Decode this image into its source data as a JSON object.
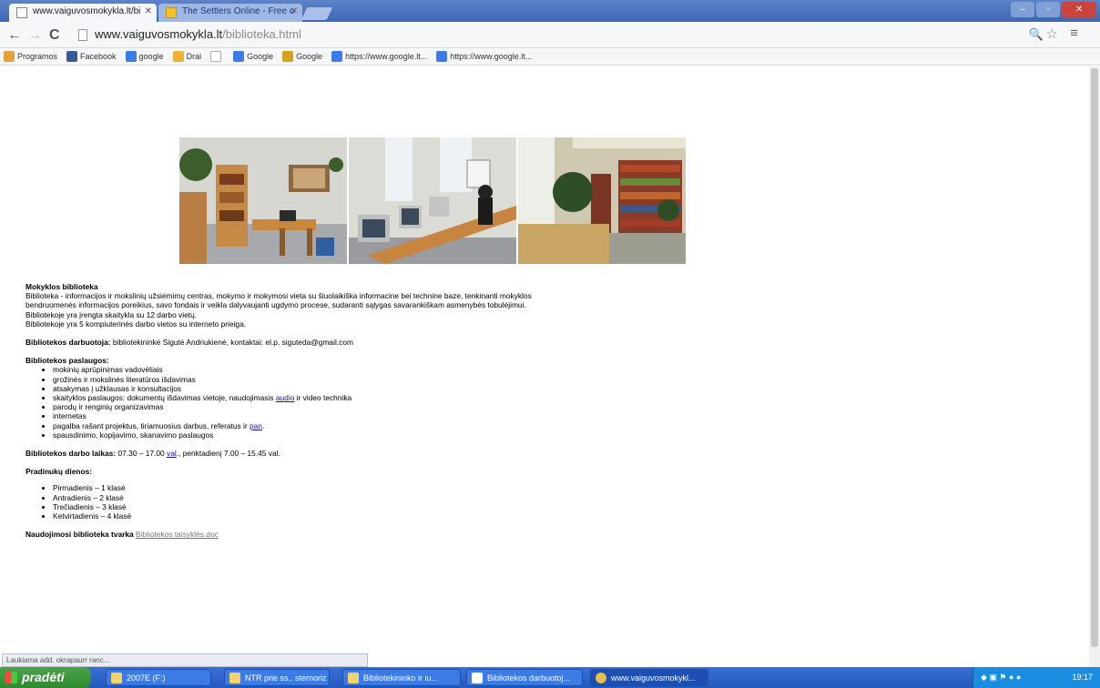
{
  "browser": {
    "tabs": [
      {
        "title": "www.vaiguvosmokykla.lt/bi"
      },
      {
        "title": "The Settlers Online - Free o"
      }
    ],
    "url_host": "www.vaiguvosmokykla.lt",
    "url_path": "/biblioteka.html",
    "bookmarks": [
      {
        "label": "Programos",
        "color": "#e8a13a"
      },
      {
        "label": "Facebook",
        "color": "#3b5998"
      },
      {
        "label": "google",
        "color": "#3d7be8"
      },
      {
        "label": "Drai",
        "color": "#f2b134"
      },
      {
        "label": "",
        "color": "#cccccc"
      },
      {
        "label": "Google",
        "color": "#3d7be8"
      },
      {
        "label": "Google",
        "color": "#d7a21b"
      },
      {
        "label": "https://www.google.lt...",
        "color": "#3d7be8"
      },
      {
        "label": "https://www.google.lt...",
        "color": "#3d7be8"
      }
    ]
  },
  "page": {
    "section1_title": "Mokyklos biblioteka",
    "section1_lines": [
      "Biblioteka - informacijos ir mokslinių užsiėmimų centras, mokymo ir mokymosi vieta su šiuolaikiška informacine bei technine baze, tenkinanti mokyklos",
      "bendruomenės informacijos poreikius, savo fondais ir veikla dalyvaujanti ugdymo procese, sudaranti sąlygas savarankiškam asmenybės tobulėjimui.",
      "Bibliotekoje yra įrengta skaitykla su 12 darbo vietų.",
      "Bibliotekoje yra 5 kompiuterinės darbo vietos su interneto prieiga."
    ],
    "worker_label": "Bibliotekos darbuotoja:",
    "worker_text": "bibliotekininkė Sigutė Andriukienė, kontaktai: el.p. siguteda@gmail.com",
    "services_title": "Bibliotekos paslaugos:",
    "services": [
      {
        "text": "mokinių aprūpinimas vadovėliais"
      },
      {
        "text": "grožinės ir mokslinės literatūros išdavimas"
      },
      {
        "text": "atsakymas į užklausas ir konsultacijos"
      },
      {
        "text": "skaityklos paslaugos: dokumentų išdavimas vietoje, naudojimasis ",
        "link": "audio",
        "after": " ir video technika"
      },
      {
        "text": "parodų ir renginių organizavimas"
      },
      {
        "text": "internetas"
      },
      {
        "text": "pagalba rašant projektus, tiriamuosius darbus, referatus ir ",
        "link": "pan",
        "after": "."
      },
      {
        "text": "spausdinimo, kopijavimo, skanavimo paslaugos"
      }
    ],
    "hours_label": "Bibliotekos darbo laikas:",
    "hours_pre": " 07.30 – 17.00 ",
    "hours_link": "val",
    "hours_post": "., penktadienį 7.00 – 15.45 val.",
    "classes_title": "Pradinukų dienos:",
    "classes": [
      "Pirmadienis – 1 klasė",
      "Antradienis – 2 klasė",
      "Trečiadienis – 3 klasė",
      "Ketvirtadienis – 4 klasė"
    ],
    "rules_label": "Naudojimosi biblioteka tvarka",
    "rules_link": "Bibliotekos taisyklės.doc"
  },
  "status_text": "Laukiama add. okrapaurr ranc...",
  "taskbar": {
    "start_label": "pradėti",
    "tasks": [
      {
        "label": "2007E (F:)"
      },
      {
        "label": "NTR prie ss.. sternoriz"
      },
      {
        "label": "Bibliotekininko ir iu..."
      },
      {
        "label": "Bibliotekos darbuotoj..."
      },
      {
        "label": "www.vaiguvosmokykl..."
      }
    ],
    "clock": "19:17"
  }
}
